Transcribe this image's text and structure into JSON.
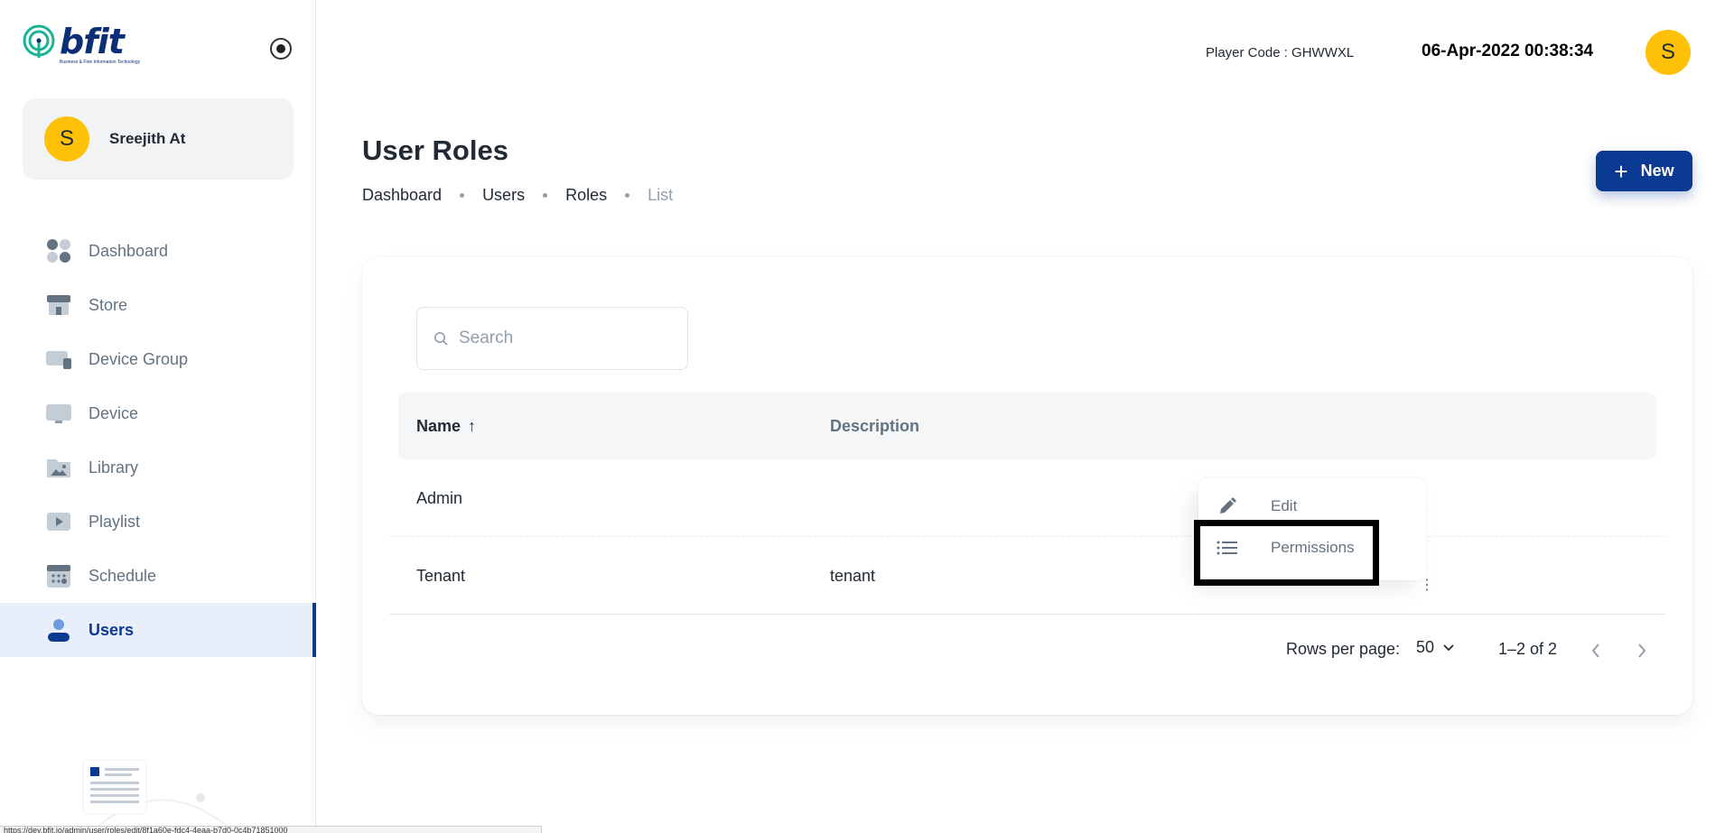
{
  "brand": {
    "logo_text": "bfit",
    "tagline": "Business & Fine Information Technology"
  },
  "user": {
    "initial": "S",
    "name": "Sreejith At"
  },
  "sidebar": {
    "items": [
      {
        "label": "Dashboard",
        "icon": "dashboard-icon",
        "active": false
      },
      {
        "label": "Store",
        "icon": "store-icon",
        "active": false
      },
      {
        "label": "Device Group",
        "icon": "device-group-icon",
        "active": false
      },
      {
        "label": "Device",
        "icon": "device-icon",
        "active": false
      },
      {
        "label": "Library",
        "icon": "library-icon",
        "active": false
      },
      {
        "label": "Playlist",
        "icon": "playlist-icon",
        "active": false
      },
      {
        "label": "Schedule",
        "icon": "schedule-icon",
        "active": false
      },
      {
        "label": "Users",
        "icon": "users-icon",
        "active": true
      }
    ]
  },
  "header": {
    "player_code": "Player Code : GHWWXL",
    "datetime": "06-Apr-2022 00:38:34",
    "avatar_initial": "S"
  },
  "page": {
    "title": "User Roles",
    "breadcrumb": [
      "Dashboard",
      "Users",
      "Roles",
      "List"
    ],
    "new_button": "New"
  },
  "search": {
    "placeholder": "Search",
    "value": ""
  },
  "table": {
    "columns": [
      "Name",
      "Description"
    ],
    "rows": [
      {
        "name": "Admin",
        "description": ""
      },
      {
        "name": "Tenant",
        "description": "tenant"
      }
    ]
  },
  "pagination": {
    "rows_per_page_label": "Rows per page:",
    "rows_per_page": "50",
    "range": "1–2 of 2"
  },
  "context_menu": {
    "items": [
      {
        "label": "Edit",
        "icon": "pencil-icon"
      },
      {
        "label": "Permissions",
        "icon": "list-icon"
      }
    ]
  },
  "status_bar": {
    "url": "https://dev.bfit.io/admin/user/roles/edit/8f1a60e-fdc4-4eaa-b7d0-0c4b71851000"
  },
  "colors": {
    "accent": "#0b3a93",
    "avatar": "#ffc107",
    "logo_teal": "#1ab394"
  }
}
